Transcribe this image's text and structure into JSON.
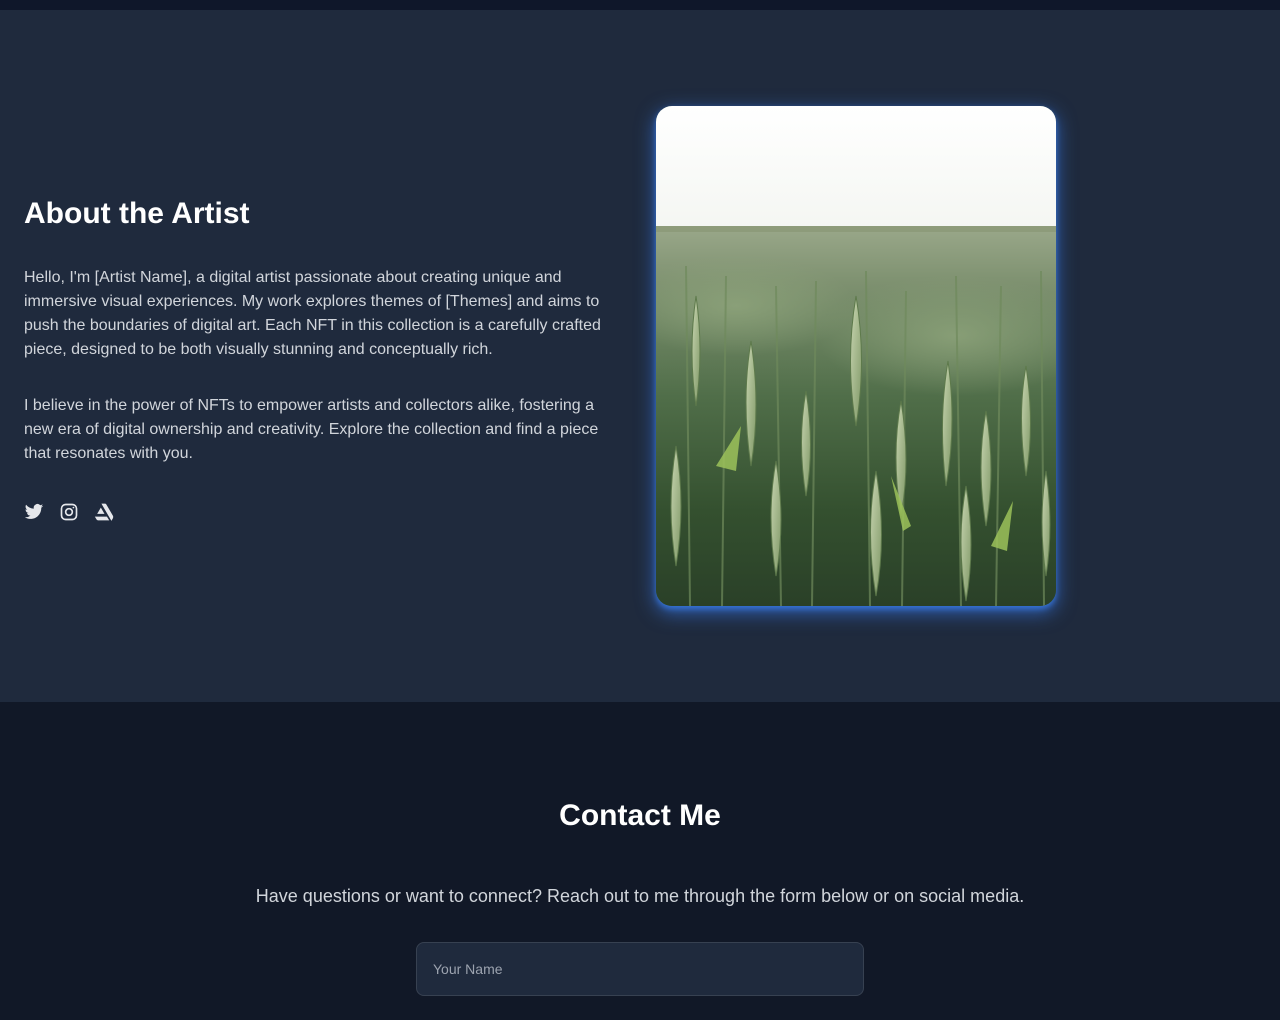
{
  "about": {
    "title": "About the Artist",
    "paragraph_1": "Hello, I'm [Artist Name], a digital artist passionate about creating unique and immersive visual experiences. My work explores themes of [Themes] and aims to push the boundaries of digital art. Each NFT in this collection is a carefully crafted piece, designed to be both visually stunning and conceptually rich.",
    "paragraph_2": "I believe in the power of NFTs to empower artists and collectors alike, fostering a new era of digital ownership and creativity. Explore the collection and find a piece that resonates with you.",
    "socials": [
      {
        "icon": "twitter-icon"
      },
      {
        "icon": "instagram-icon"
      },
      {
        "icon": "artstation-icon"
      }
    ],
    "image": {
      "subject": "wheat-field-photo",
      "accent_glow": "#3b82f6"
    }
  },
  "contact": {
    "title": "Contact Me",
    "subtitle": "Have questions or want to connect? Reach out to me through the form below or on social media.",
    "name_placeholder": "Your Name",
    "name_value": ""
  },
  "colors": {
    "page_bg": "#111827",
    "section_bg": "#1f2a3d",
    "accent": "#3b82f6",
    "text_muted": "#d1d5db"
  }
}
